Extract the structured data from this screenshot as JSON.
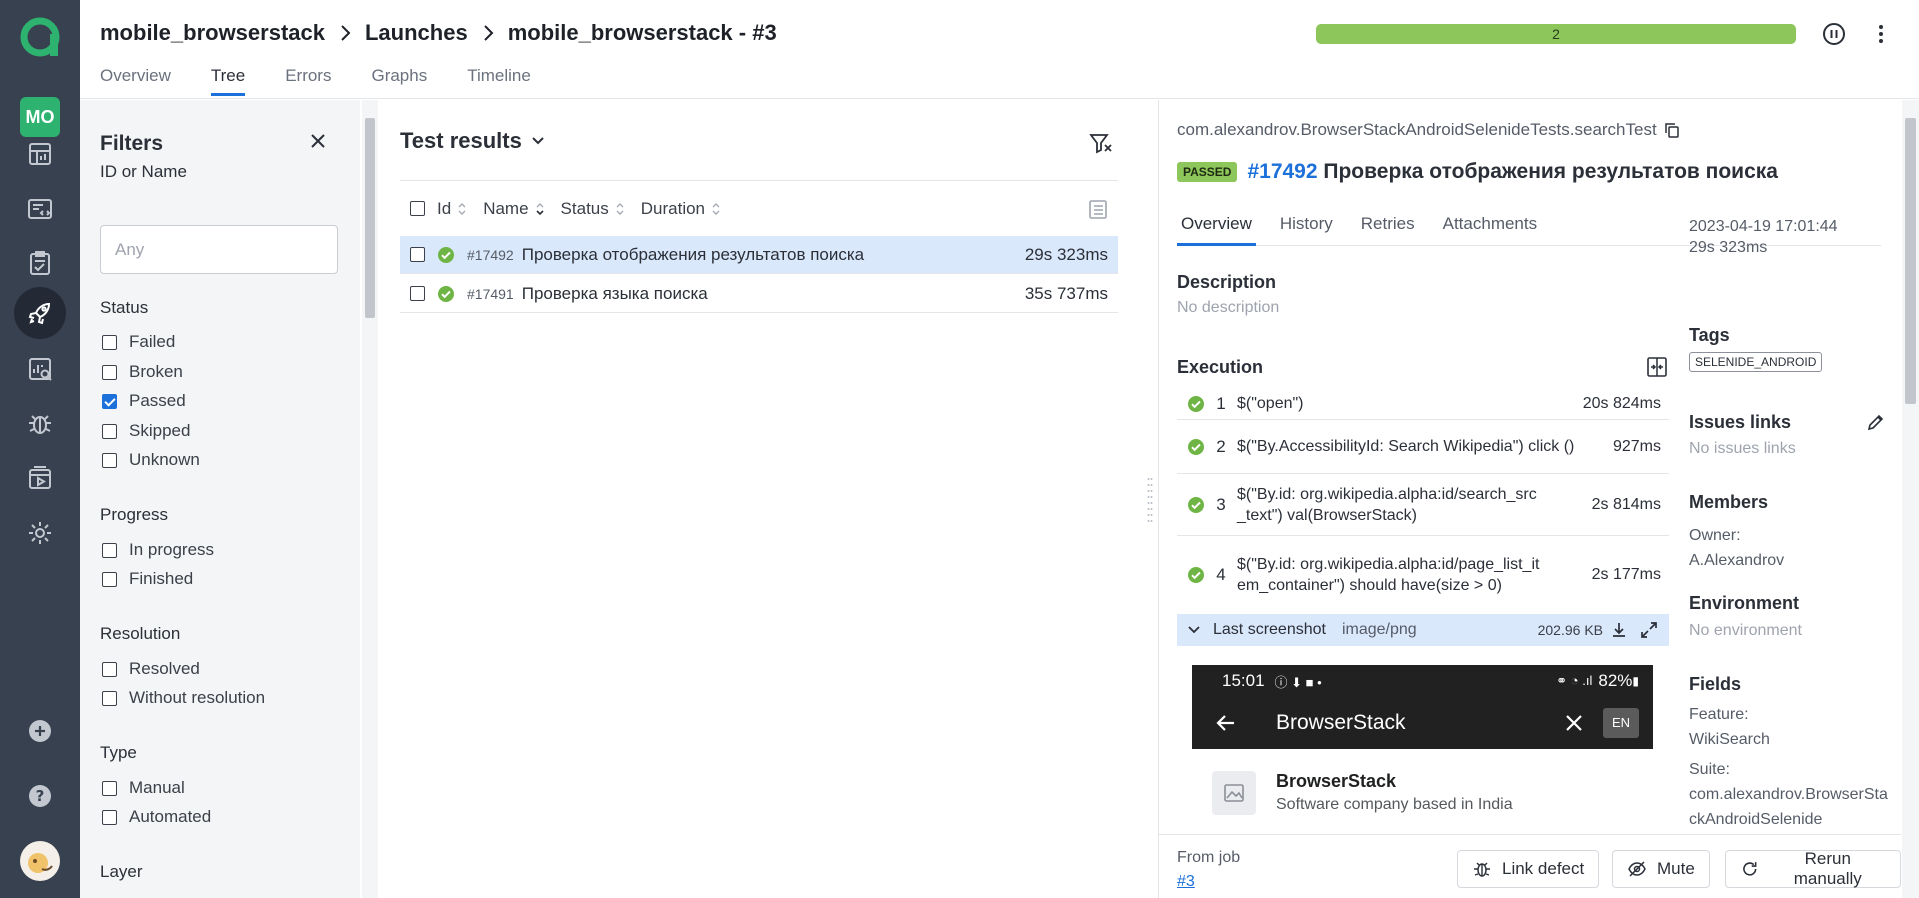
{
  "nav": {
    "project_initials": "MO",
    "items": [
      "dashboards-icon",
      "launches-icon",
      "testcases-icon",
      "jobs-icon",
      "analytics-icon",
      "defects-icon",
      "testplans-icon",
      "settings-icon"
    ],
    "active": "jobs-icon"
  },
  "header": {
    "breadcrumbs": [
      "mobile_browserstack",
      "Launches",
      "mobile_browserstack - #3"
    ],
    "tabs": [
      "Overview",
      "Tree",
      "Errors",
      "Graphs",
      "Timeline"
    ],
    "active_tab": "Tree",
    "progress_label": "2",
    "progress_fraction": 1.0,
    "progress_color": "#8dc65b"
  },
  "filters": {
    "title": "Filters",
    "id_label": "ID or Name",
    "id_placeholder": "Any",
    "status_label": "Status",
    "status": [
      {
        "label": "Failed",
        "checked": false
      },
      {
        "label": "Broken",
        "checked": false
      },
      {
        "label": "Passed",
        "checked": true
      },
      {
        "label": "Skipped",
        "checked": false
      },
      {
        "label": "Unknown",
        "checked": false
      }
    ],
    "progress_label": "Progress",
    "progress": [
      {
        "label": "In progress",
        "checked": false
      },
      {
        "label": "Finished",
        "checked": false
      }
    ],
    "resolution_label": "Resolution",
    "resolution": [
      {
        "label": "Resolved",
        "checked": false
      },
      {
        "label": "Without resolution",
        "checked": false
      }
    ],
    "type_label": "Type",
    "type": [
      {
        "label": "Manual",
        "checked": false
      },
      {
        "label": "Automated",
        "checked": false
      }
    ],
    "layer_label": "Layer"
  },
  "results": {
    "title": "Test results",
    "columns": [
      "Id",
      "Name",
      "Status",
      "Duration"
    ],
    "rows": [
      {
        "id": "#17492",
        "name": "Проверка отображения результатов поиска",
        "duration": "29s 323ms",
        "selected": true
      },
      {
        "id": "#17491",
        "name": "Проверка языка поиска",
        "duration": "35s 737ms",
        "selected": false
      }
    ]
  },
  "detail": {
    "path": "com.alexandrov.BrowserStackAndroidSelenideTests.searchTest",
    "status_badge": "PASSED",
    "id": "#17492",
    "title": "Проверка отображения результатов поиска",
    "tabs": [
      "Overview",
      "History",
      "Retries",
      "Attachments"
    ],
    "active_tab": "Overview",
    "description_label": "Description",
    "description": "No description",
    "execution_label": "Execution",
    "steps": [
      {
        "no": "1",
        "text": "$(\"open\")",
        "duration": "20s 824ms"
      },
      {
        "no": "2",
        "text": "$(\"By.AccessibilityId: Search Wikipedia\") click ()",
        "duration": "927ms"
      },
      {
        "no": "3",
        "text": "$(\"By.id: org.wikipedia.alpha:id/search_src _text\") val(BrowserStack)",
        "duration": "2s 814ms"
      },
      {
        "no": "4",
        "text": "$(\"By.id: org.wikipedia.alpha:id/page_list_it em_container\") should have(size > 0)",
        "duration": "2s 177ms"
      }
    ],
    "attachment": {
      "label": "Last screenshot",
      "mime": "image/png",
      "size": "202.96 KB"
    },
    "phone": {
      "time": "15:01",
      "battery": "82%",
      "query": "BrowserStack",
      "lang": "EN",
      "result_title": "BrowserStack",
      "result_subtitle": "Software company based in India"
    },
    "created": "2023-04-19 17:01:44",
    "duration": "29s 323ms",
    "tags_label": "Tags",
    "tags": [
      "SELENIDE_ANDROID"
    ],
    "issues_label": "Issues links",
    "issues": "No issues links",
    "members_label": "Members",
    "owner_label": "Owner:",
    "owner": "A.Alexandrov",
    "environment_label": "Environment",
    "environment": "No environment",
    "fields_label": "Fields",
    "feature_label": "Feature:",
    "feature": "WikiSearch",
    "suite_label": "Suite:",
    "suite": "com.alexandrov.BrowserStackAndroidSelenide"
  },
  "footer": {
    "from_job_label": "From job",
    "job": "#3",
    "link_defect": "Link defect",
    "mute": "Mute",
    "rerun": "Rerun manually"
  }
}
